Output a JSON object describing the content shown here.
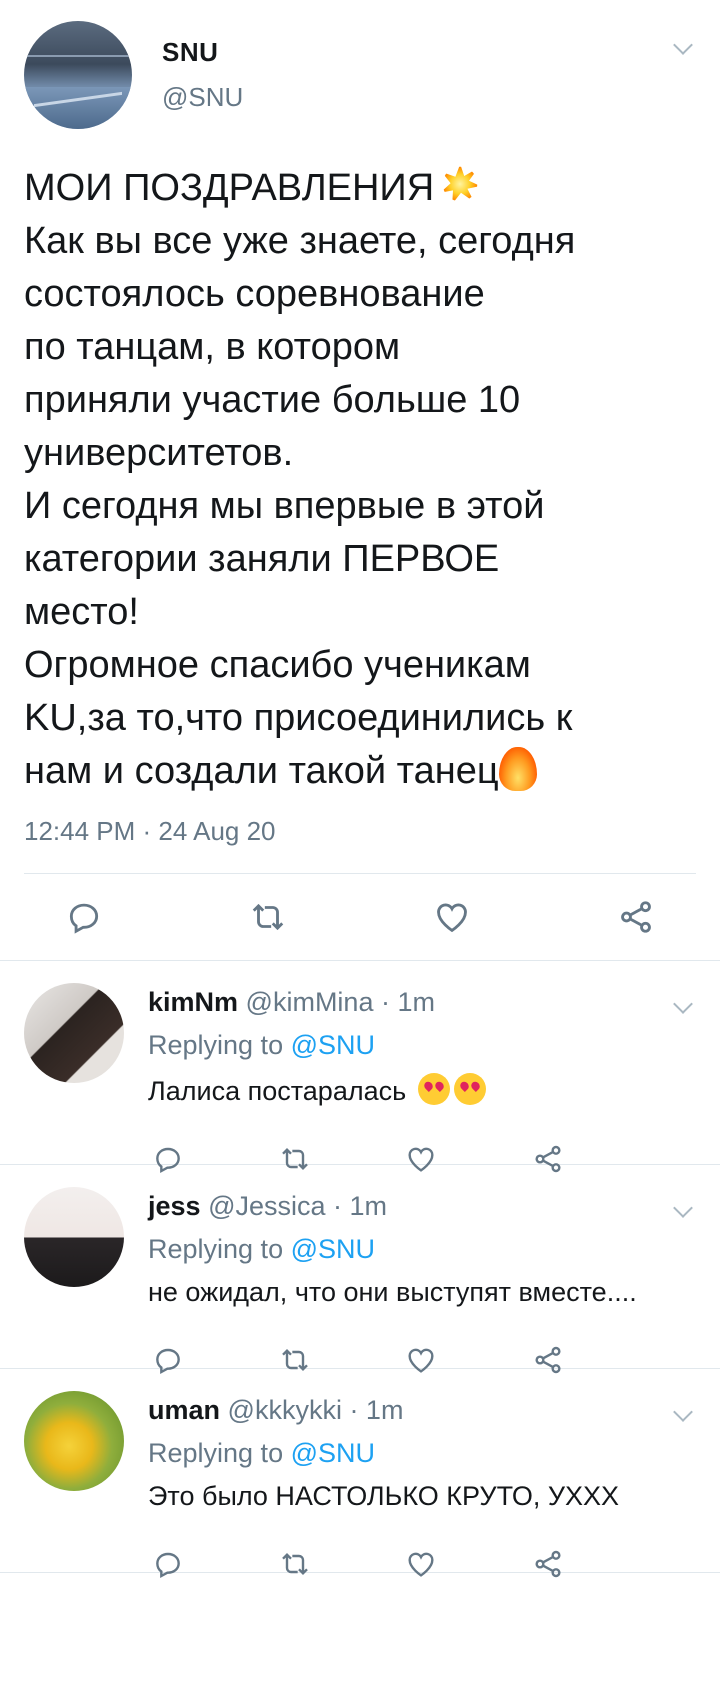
{
  "main_tweet": {
    "name": "SNU",
    "handle": "@SNU",
    "text_lines": [
      "МОИ ПОЗДРАВЛЕНИЯ",
      "Как вы все уже знаете, сегодня",
      "состоялось соревнование",
      "по танцам, в котором",
      "приняли участие больше 10",
      "университетов.",
      "И сегодня мы впервые в этой",
      "категории заняли ПЕРВОЕ",
      "место!",
      "Огромное спасибо ученикам",
      "KU,за то,что присоединились к",
      "нам и создали такой танец"
    ],
    "timestamp": "12:44 PM · 24 Aug 20"
  },
  "replies": [
    {
      "name": "kimNm",
      "meta": "@kimMina · 1m",
      "replying_prefix": "Replying to",
      "mention": "@SNU",
      "text": "Лалиса постаралась"
    },
    {
      "name": "jess",
      "meta": "@Jessica · 1m",
      "replying_prefix": "Replying to",
      "mention": "@SNU",
      "text": "не ожидал, что они выступят вместе...."
    },
    {
      "name": "uman",
      "meta": "@kkkykki · 1m",
      "replying_prefix": "Replying to",
      "mention": "@SNU",
      "text": "Это было НАСТОЛЬКО КРУТО, УХХХ"
    }
  ],
  "icons": [
    "reply-icon",
    "retweet-icon",
    "like-icon",
    "share-icon",
    "chevron-down-icon",
    "collision-emoji",
    "fire-emoji",
    "heart-eyes-emoji"
  ],
  "colors": {
    "text": "#14171a",
    "secondary": "#657786",
    "link": "#1da1f2",
    "divider": "#e1e8ed"
  }
}
